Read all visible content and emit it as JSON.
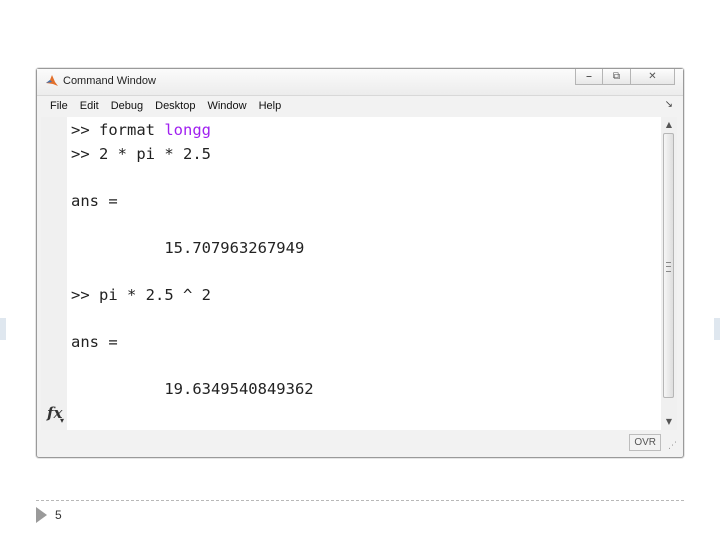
{
  "window": {
    "title": "Command Window",
    "controls": {
      "minimize": "⎯",
      "maximize": "⧉",
      "close": "✕"
    }
  },
  "menu": {
    "items": [
      "File",
      "Edit",
      "Debug",
      "Desktop",
      "Window",
      "Help"
    ],
    "overflow_icon": "chevron-down-icon"
  },
  "console": {
    "lines": [
      {
        "prompt": ">> ",
        "code": "format ",
        "keyword": "longg"
      },
      {
        "prompt": ">> ",
        "code": "2 * pi * 2.5",
        "keyword": ""
      },
      {
        "prompt": "",
        "code": "ans =",
        "keyword": ""
      },
      {
        "prompt": "",
        "code": "          15.707963267949",
        "keyword": ""
      },
      {
        "prompt": ">> ",
        "code": "pi * 2.5 ^ 2",
        "keyword": ""
      },
      {
        "prompt": "",
        "code": "ans =",
        "keyword": ""
      },
      {
        "prompt": "",
        "code": "          19.6349540849362",
        "keyword": ""
      }
    ],
    "fx_label": "fx"
  },
  "status": {
    "mode": "OVR"
  },
  "slide": {
    "page_number": "5"
  },
  "colors": {
    "keyword": "#a020f0",
    "text": "#222222"
  }
}
